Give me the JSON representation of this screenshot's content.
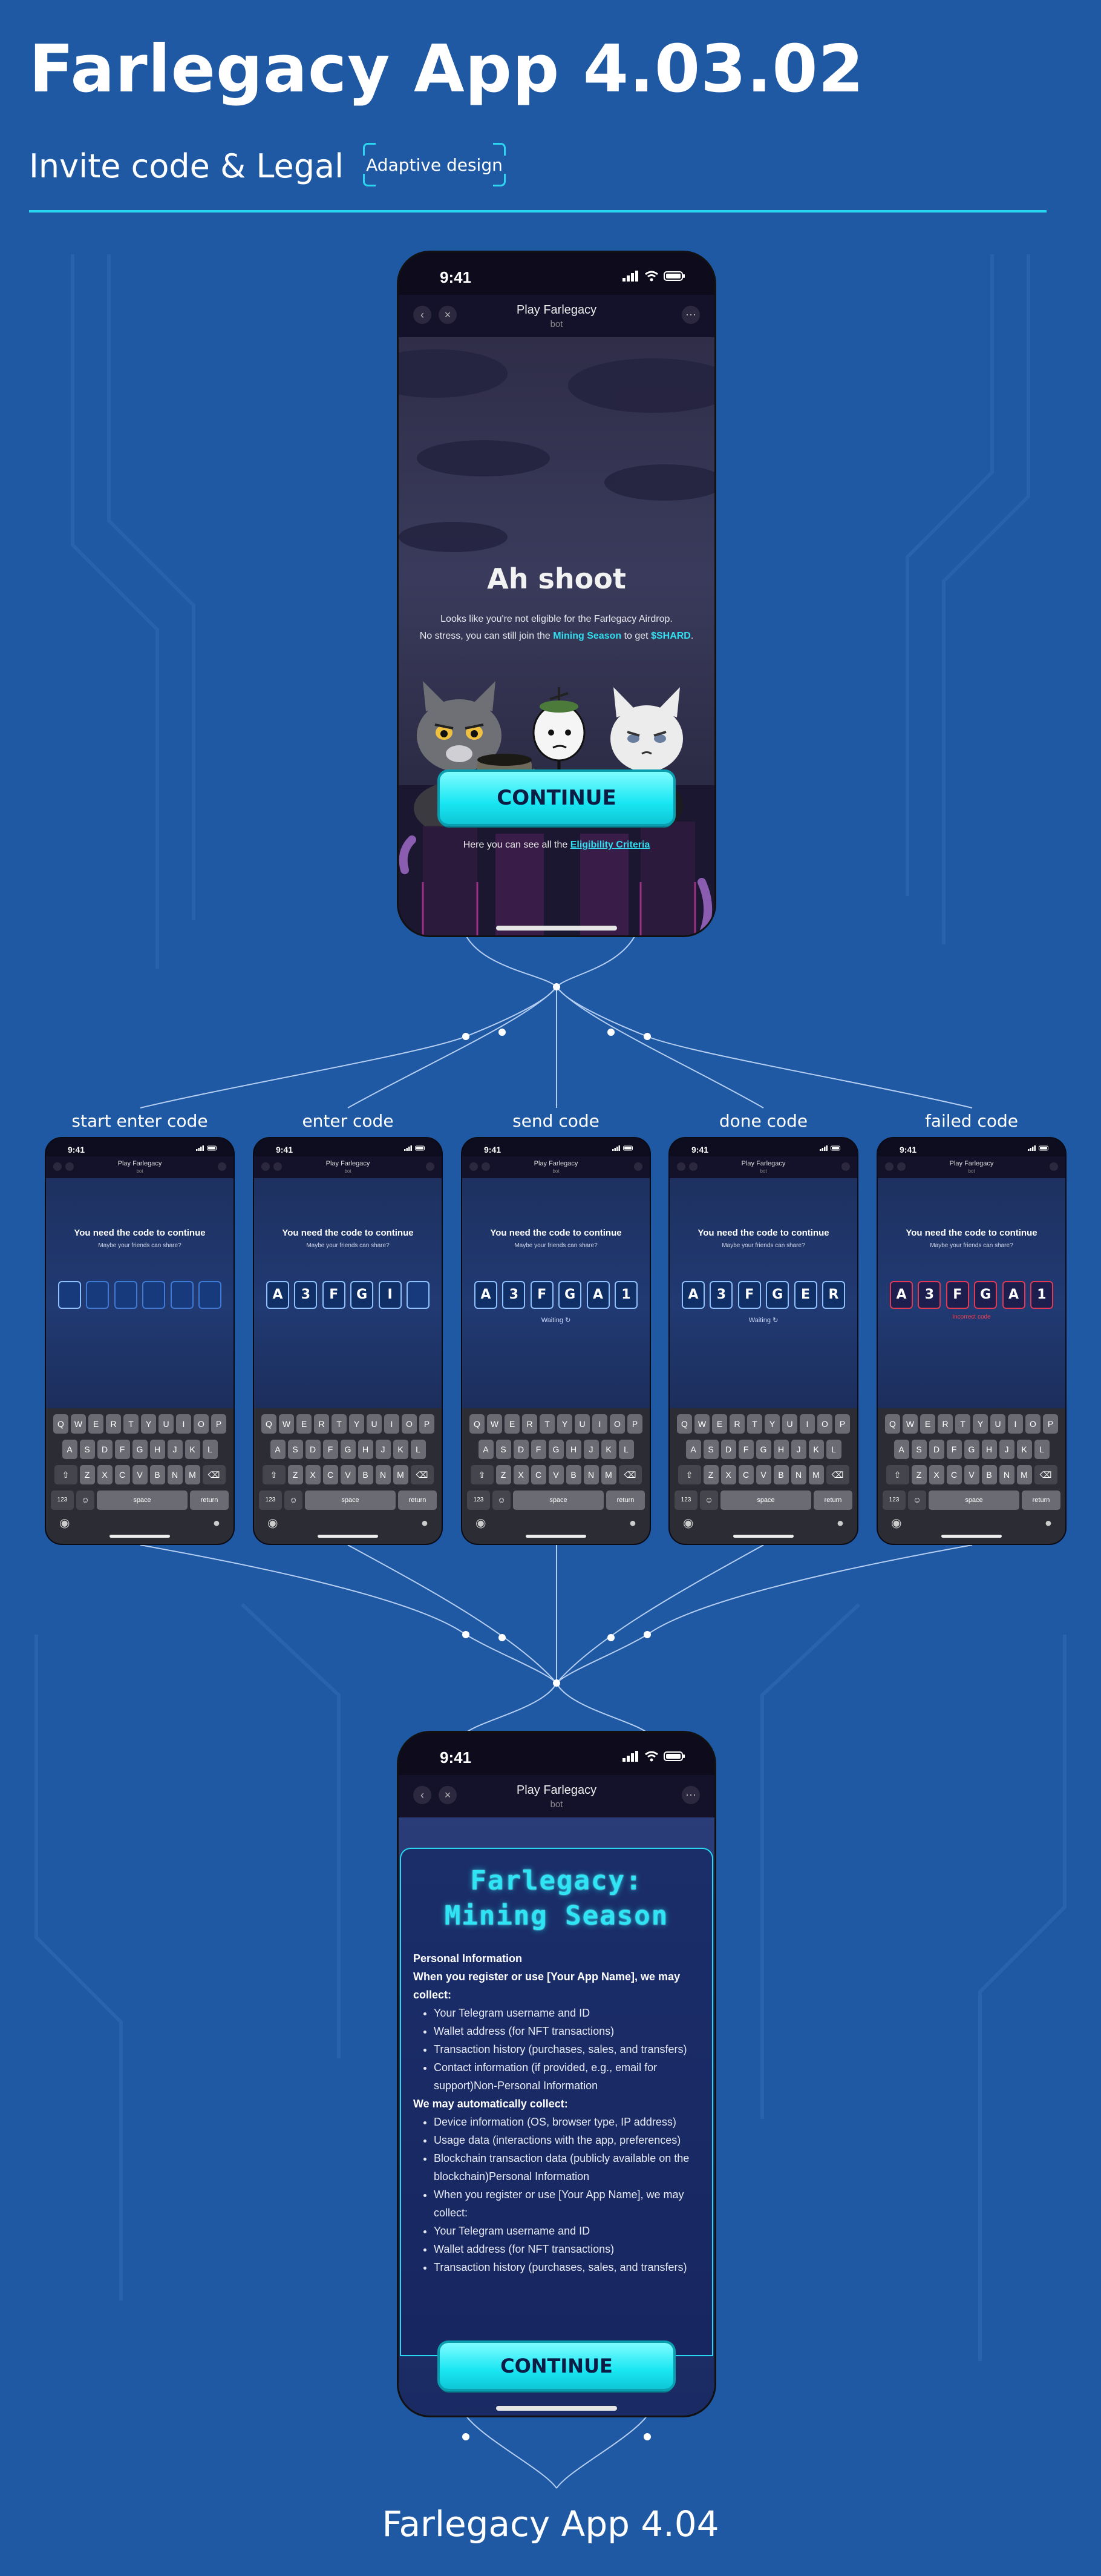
{
  "header": {
    "title": "Farlegacy App 4.03.02",
    "subtitle": "Invite code & Legal",
    "badge": "Adaptive design"
  },
  "footer": {
    "title": "Farlegacy App 4.04"
  },
  "colors": {
    "background": "#1f58a3",
    "accent": "#2ad6f0",
    "button": "#18e6f2",
    "error": "#e23a55"
  },
  "phone_common": {
    "time": "9:41",
    "telegram_title": "Play Farlegacy",
    "telegram_sub": "bot",
    "back_icon": "chevron-left-icon",
    "close_icon": "close-icon",
    "more_icon": "more-icon"
  },
  "not_eligible": {
    "heading": "Ah shoot",
    "line1": "Looks like you're not eligible for the Farlegacy Airdrop.",
    "line2_prefix": "No stress, you can still join the ",
    "line2_link": "Mining Season",
    "line2_mid": " to get ",
    "line2_token": "$SHARD",
    "line2_end": ".",
    "continue": "CONTINUE",
    "criteria_prefix": "Here you can see all the ",
    "criteria_link": "Eligibility Criteria"
  },
  "code_screen": {
    "heading": "You need the code to continue",
    "sub": "Maybe your friends can share?",
    "keyboard": {
      "row1": [
        "Q",
        "W",
        "E",
        "R",
        "T",
        "Y",
        "U",
        "I",
        "O",
        "P"
      ],
      "row2": [
        "A",
        "S",
        "D",
        "F",
        "G",
        "H",
        "J",
        "K",
        "L"
      ],
      "row3": [
        "Z",
        "X",
        "C",
        "V",
        "B",
        "N",
        "M"
      ],
      "num": "123",
      "space": "space",
      "return": "return"
    }
  },
  "states": [
    {
      "label": "start enter code",
      "codes": [
        "",
        "",
        "",
        "",
        "",
        ""
      ],
      "status": ""
    },
    {
      "label": "enter code",
      "codes": [
        "A",
        "3",
        "F",
        "G",
        "I",
        ""
      ],
      "status": ""
    },
    {
      "label": "send code",
      "codes": [
        "A",
        "3",
        "F",
        "G",
        "A",
        "1"
      ],
      "status": "Waiting"
    },
    {
      "label": "done code",
      "codes": [
        "A",
        "3",
        "F",
        "G",
        "E",
        "R"
      ],
      "status": "Waiting"
    },
    {
      "label": "failed code",
      "codes": [
        "A",
        "3",
        "F",
        "G",
        "A",
        "1"
      ],
      "status": "Incorrect code"
    }
  ],
  "legal": {
    "title_line1": "Farlegacy:",
    "title_line2": "Mining Season",
    "section1": "Personal Information",
    "intro": "When you register or use [Your App Name], we may collect:",
    "items1": [
      "Your Telegram username and ID",
      "Wallet address (for NFT transactions)",
      "Transaction history (purchases, sales, and transfers)",
      "Contact information (if provided, e.g., email for support)Non-Personal Information"
    ],
    "auto": "We may automatically collect:",
    "items2": [
      "Device information (OS, browser type, IP address)",
      "Usage data (interactions with the app, preferences)",
      "Blockchain transaction data (publicly available on the blockchain)Personal Information",
      "When you register or use [Your App Name], we may collect:",
      "Your Telegram username and ID",
      "Wallet address (for NFT transactions)",
      "Transaction history (purchases, sales, and transfers)"
    ],
    "continue": "CONTINUE"
  }
}
